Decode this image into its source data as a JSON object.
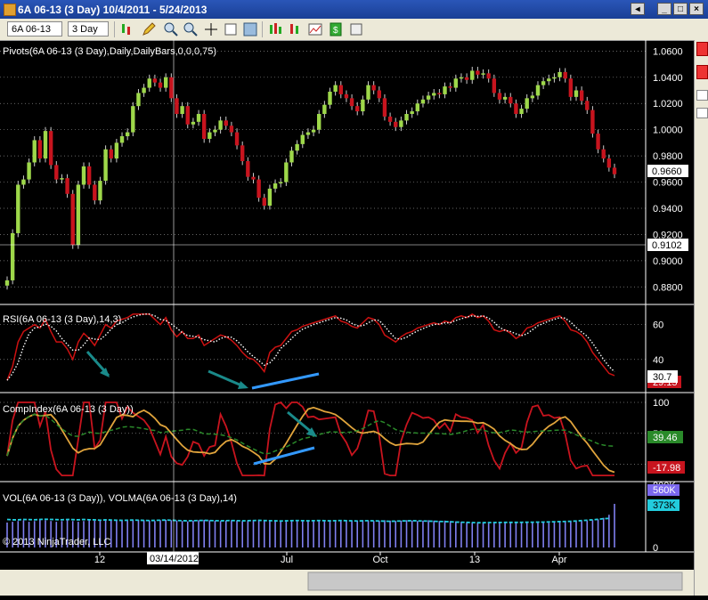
{
  "window": {
    "title": "6A 06-13 (3 Day)  10/4/2011 - 5/24/2013"
  },
  "toolbar": {
    "instrument": "6A 06-13",
    "interval": "3 Day"
  },
  "panels": {
    "pivots_label": "Pivots(6A 06-13 (3 Day),Daily,DailyBars,0,0,0,75)",
    "rsi_label": "RSI(6A 06-13 (3 Day),14,3)",
    "comp_label": "CompIndex(6A 06-13 (3 Day))",
    "vol_label": "VOL(6A 06-13 (3 Day)), VOLMA(6A 06-13 (3 Day),14)",
    "copyright": "© 2013 NinjaTrader, LLC"
  },
  "price_axis": {
    "ticks": [
      "1.0600",
      "1.0400",
      "1.0200",
      "1.0000",
      "0.9800",
      "0.9600",
      "0.9400",
      "0.9200",
      "0.9000",
      "0.8800"
    ],
    "last_price": "0.9660",
    "crosshair_price": "0.9102"
  },
  "rsi_axis": {
    "ticks": [
      "60",
      "40"
    ],
    "value_a": "30.7",
    "value_b": "29.15"
  },
  "comp_axis": {
    "ticks": [
      "100",
      "50",
      "0"
    ],
    "value_a": "39.46",
    "value_b": "-17.98"
  },
  "vol_axis": {
    "ticks": [
      "800K",
      "0"
    ],
    "value_a": "560K",
    "value_b": "373K"
  },
  "time_axis": {
    "labels": [
      "12",
      "Jul",
      "Oct",
      "13",
      "Apr"
    ],
    "crosshair_date": "03/14/2012"
  },
  "colors": {
    "up": "#9ed84a",
    "down": "#c8141e",
    "rsi": "#cc1111",
    "comp": "#c8141e",
    "comp_slow": "#e0a43c",
    "comp_green": "#2a8a2a",
    "vol": "#8080f0",
    "volma": "#22ccdd",
    "arrow_teal": "#1a8a8a",
    "arrow_blue": "#3399ff"
  },
  "chart_data": {
    "type": "candlestick",
    "price_closes": [
      0.885,
      0.921,
      0.958,
      0.962,
      0.975,
      0.992,
      0.978,
      0.999,
      0.973,
      0.962,
      0.963,
      0.951,
      0.912,
      0.958,
      0.972,
      0.958,
      0.946,
      0.961,
      0.985,
      0.978,
      0.99,
      0.995,
      0.998,
      1.018,
      1.028,
      1.032,
      1.039,
      1.036,
      1.032,
      1.04,
      1.024,
      1.012,
      1.018,
      1.004,
      1.006,
      1.012,
      0.993,
      0.998,
      1.0,
      1.007,
      1.003,
      0.998,
      0.988,
      0.976,
      0.964,
      0.962,
      0.948,
      0.942,
      0.955,
      0.959,
      0.96,
      0.975,
      0.984,
      0.989,
      0.996,
      0.998,
      1.0,
      1.012,
      1.019,
      1.029,
      1.034,
      1.027,
      1.024,
      1.018,
      1.014,
      1.023,
      1.034,
      1.03,
      1.024,
      1.01,
      1.006,
      1.002,
      1.007,
      1.012,
      1.014,
      1.02,
      1.023,
      1.026,
      1.028,
      1.027,
      1.033,
      1.032,
      1.039,
      1.04,
      1.038,
      1.045,
      1.042,
      1.043,
      1.039,
      1.028,
      1.023,
      1.025,
      1.02,
      1.012,
      1.016,
      1.024,
      1.026,
      1.034,
      1.037,
      1.039,
      1.04,
      1.044,
      1.039,
      1.025,
      1.03,
      1.022,
      1.015,
      0.997,
      0.985,
      0.978,
      0.971,
      0.966
    ],
    "rsi": [
      28,
      36,
      50,
      56,
      58,
      60,
      58,
      63,
      56,
      50,
      50,
      46,
      40,
      50,
      55,
      52,
      48,
      54,
      60,
      58,
      62,
      63,
      64,
      66,
      66,
      66,
      66,
      63,
      60,
      64,
      57,
      53,
      56,
      52,
      52,
      54,
      48,
      50,
      52,
      54,
      53,
      51,
      48,
      44,
      41,
      40,
      37,
      33,
      44,
      47,
      48,
      52,
      56,
      57,
      59,
      60,
      61,
      62,
      63,
      64,
      65,
      62,
      61,
      59,
      58,
      61,
      64,
      63,
      60,
      54,
      52,
      50,
      53,
      55,
      56,
      58,
      59,
      60,
      61,
      60,
      62,
      61,
      64,
      65,
      64,
      66,
      64,
      65,
      62,
      57,
      56,
      57,
      55,
      52,
      54,
      58,
      59,
      61,
      62,
      63,
      64,
      65,
      62,
      57,
      56,
      54,
      50,
      44,
      40,
      36,
      32,
      30.7
    ],
    "volume": [
      320,
      330,
      340,
      350,
      330,
      340,
      360,
      350,
      340,
      330,
      340,
      350,
      340,
      330,
      340,
      350,
      345,
      350,
      355,
      350,
      345,
      340,
      345,
      350,
      355,
      350,
      345,
      340,
      350,
      355,
      350,
      345,
      340,
      335,
      345,
      350,
      355,
      350,
      345,
      340,
      345,
      350,
      345,
      340,
      345,
      350,
      355,
      350,
      345,
      350,
      345,
      350,
      355,
      350,
      345,
      340,
      345,
      350,
      345,
      340,
      345,
      350,
      345,
      340,
      345,
      350,
      345,
      340,
      345,
      350,
      345,
      340,
      345,
      350,
      345,
      340,
      345,
      350,
      345,
      340,
      345,
      340,
      335,
      330,
      325,
      320,
      318,
      315,
      310,
      315,
      318,
      320,
      318,
      322,
      320,
      318,
      322,
      325,
      320,
      318,
      322,
      326,
      330,
      335,
      340,
      338,
      345,
      350,
      360,
      380,
      420,
      560
    ],
    "volma": [
      360,
      355,
      355,
      360,
      358,
      356,
      360,
      362,
      360,
      358,
      356,
      360,
      358,
      355,
      360,
      356,
      355,
      350,
      355,
      352,
      350,
      348,
      350,
      352,
      350,
      348,
      346,
      348,
      350,
      352,
      350,
      346,
      344,
      342,
      344,
      346,
      348,
      346,
      344,
      342,
      344,
      346,
      344,
      342,
      344,
      346,
      348,
      346,
      344,
      342,
      340,
      342,
      344,
      346,
      344,
      342,
      344,
      346,
      344,
      342,
      344,
      346,
      344,
      342,
      340,
      342,
      344,
      342,
      340,
      338,
      336,
      338,
      340,
      342,
      344,
      342,
      340,
      338,
      336,
      334,
      332,
      330,
      326,
      324,
      322,
      320,
      318,
      318,
      320,
      320,
      321,
      322,
      322,
      322,
      323,
      324,
      324,
      326,
      326,
      328,
      330,
      332,
      334,
      336,
      340,
      345,
      350,
      355,
      362,
      370,
      373
    ]
  }
}
